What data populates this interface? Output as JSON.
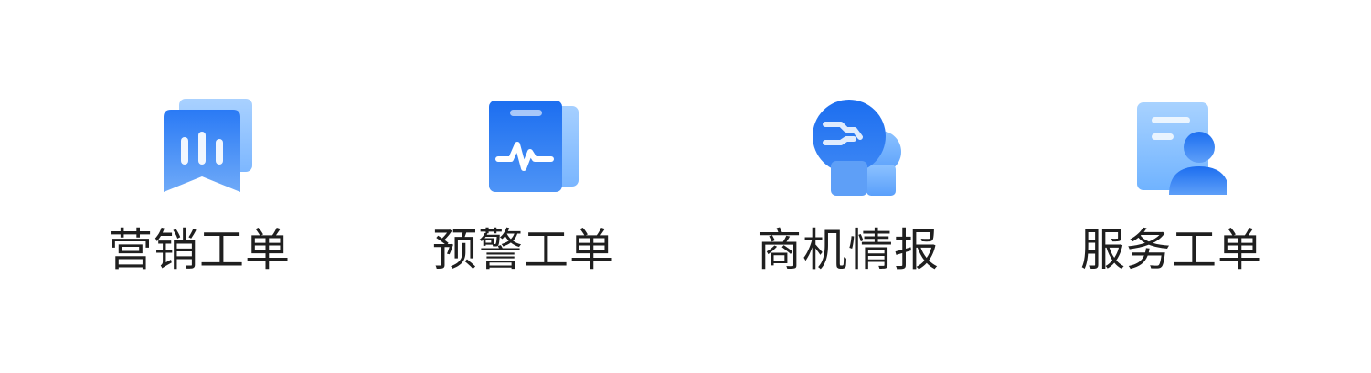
{
  "colors": {
    "primary": "#1e6ff0",
    "primary_dark": "#1560e6",
    "light": "#8fc4ff",
    "label_text": "#1f1f1f",
    "background": "#ffffff"
  },
  "menu": {
    "items": [
      {
        "label": "营销工单",
        "icon": "marketing-chart-icon"
      },
      {
        "label": "预警工单",
        "icon": "alert-pulse-icon"
      },
      {
        "label": "商机情报",
        "icon": "lightbulb-insight-icon"
      },
      {
        "label": "服务工单",
        "icon": "service-person-icon"
      }
    ]
  }
}
